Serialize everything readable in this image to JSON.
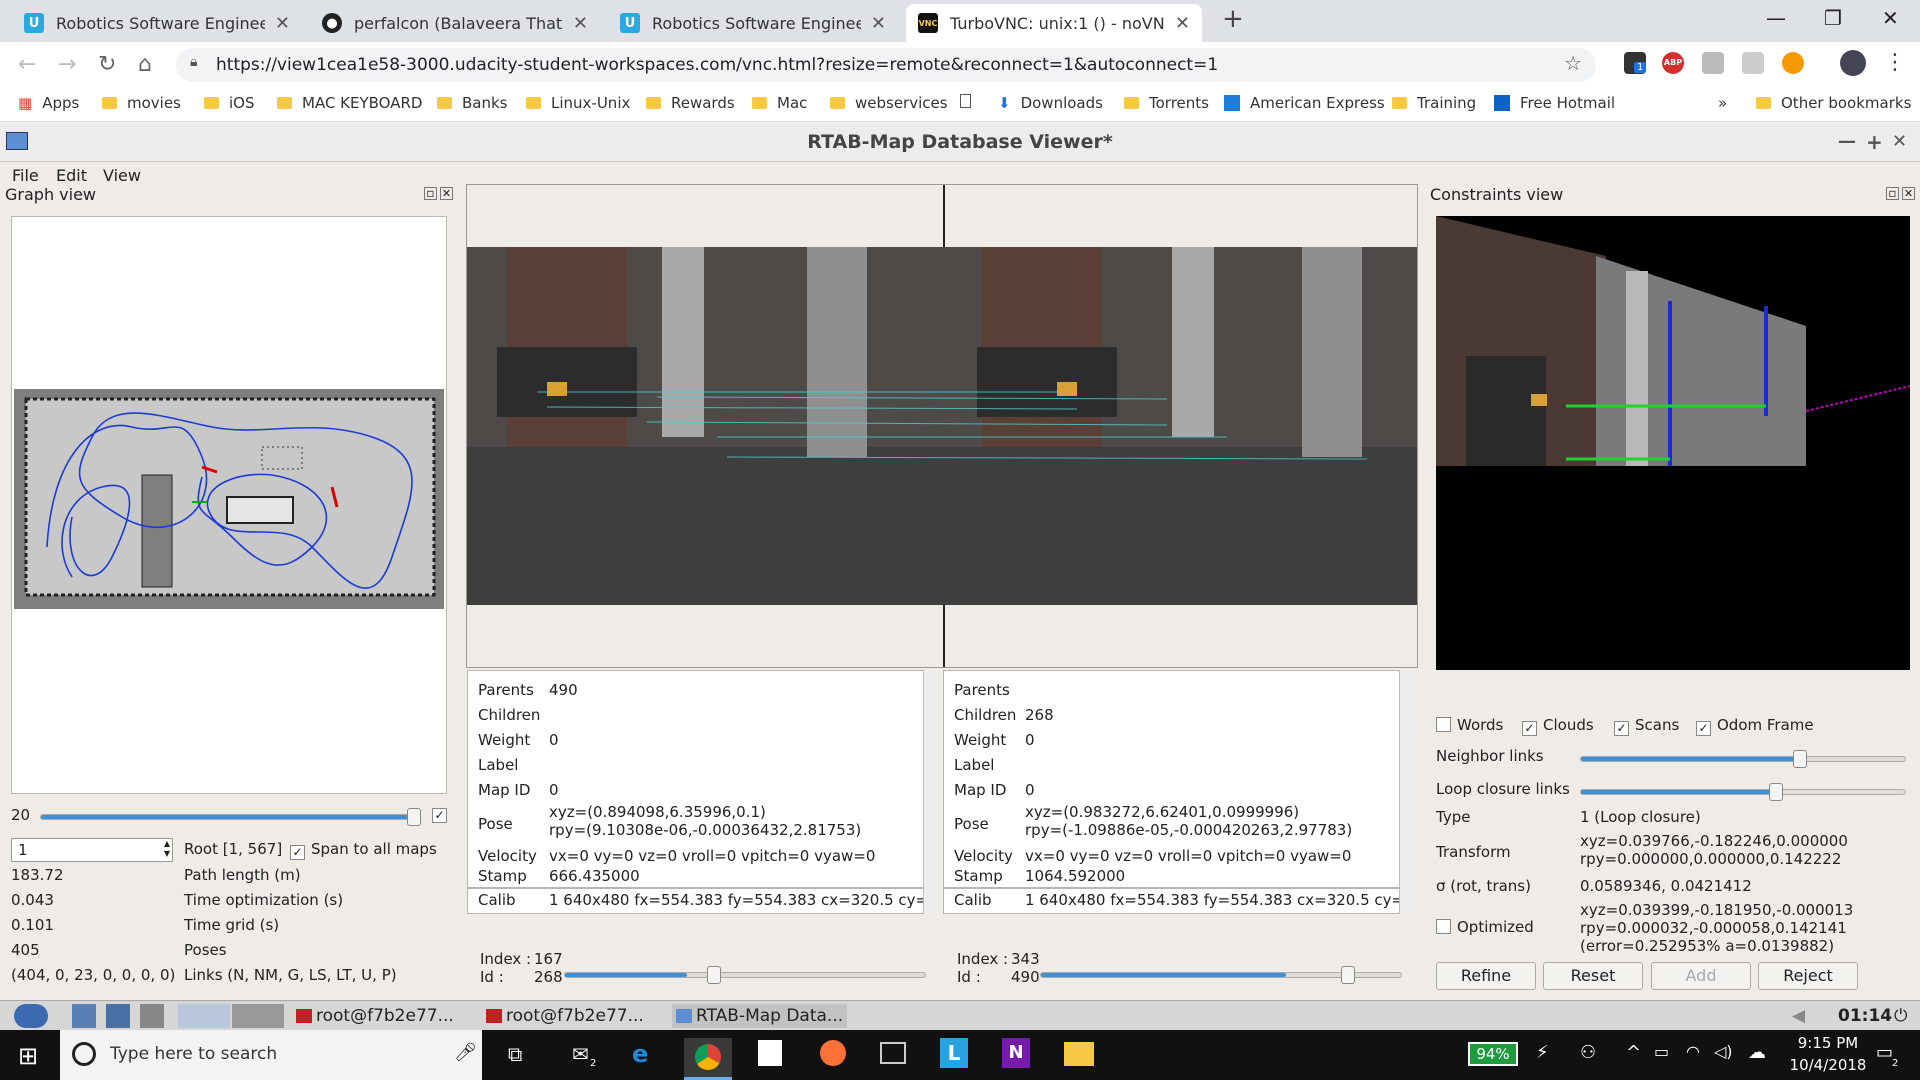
{
  "browser": {
    "tabs": [
      {
        "title": "Robotics Software Engineer - Udacity",
        "icon": "udacity-icon"
      },
      {
        "title": "perfalcon (Balaveera Thatikonda)",
        "icon": "github-icon"
      },
      {
        "title": "Robotics Software Engineer - Udacity",
        "icon": "udacity-icon"
      },
      {
        "title": "TurboVNC: unix:1 () - noVNC",
        "icon": "vnc-icon",
        "badge": "VNC"
      }
    ],
    "url": "https://view1cea1e58-3000.udacity-student-workspaces.com/vnc.html?resize=remote&reconnect=1&autoconnect=1",
    "ext_badge": "1",
    "bookmarks": [
      "Apps",
      "movies",
      "iOS",
      "MAC KEYBOARD",
      "Banks",
      "Linux-Unix",
      "Rewards",
      "Mac",
      "webservices",
      "",
      "Downloads",
      "Torrents",
      "American Express",
      "Training",
      "Free Hotmail"
    ],
    "more": "»",
    "other_bookmarks": "Other bookmarks"
  },
  "app": {
    "title": "RTAB-Map Database Viewer*",
    "menu": [
      "File",
      "Edit",
      "View"
    ],
    "graph_view": {
      "title": "Graph view",
      "slider_value": "20",
      "id_input": "1",
      "root_label": "Root [1, 567]",
      "span_label": "Span to all maps",
      "stats": [
        {
          "value": "183.72",
          "label": "Path length (m)"
        },
        {
          "value": "0.043",
          "label": "Time optimization (s)"
        },
        {
          "value": "0.101",
          "label": "Time grid (s)"
        },
        {
          "value": "405",
          "label": "Poses"
        },
        {
          "value": "(404, 0, 23, 0, 0, 0, 0)",
          "label": "Links (N, NM, G, LS, LT, U, P)"
        }
      ]
    },
    "left_node": {
      "parents": "490",
      "children": "",
      "weight": "0",
      "label": "",
      "map_id": "0",
      "pose1": "xyz=(0.894098,6.35996,0.1)",
      "pose2": "rpy=(9.10308e-06,-0.00036432,2.81753)",
      "velocity": "vx=0 vy=0 vz=0 vroll=0 vpitch=0 vyaw=0",
      "stamp": "666.435000",
      "calib": "1 640x480 fx=554.383 fy=554.383 cx=320.5 cy=",
      "index": "167",
      "id": "268"
    },
    "right_node": {
      "parents": "",
      "children": "268",
      "weight": "0",
      "label": "",
      "map_id": "0",
      "pose1": "xyz=(0.983272,6.62401,0.0999996)",
      "pose2": "rpy=(-1.09886e-05,-0.000420263,2.97783)",
      "velocity": "vx=0 vy=0 vz=0 vroll=0 vpitch=0 vyaw=0",
      "stamp": "1064.592000",
      "calib": "1 640x480 fx=554.383 fy=554.383 cx=320.5 cy=",
      "index": "343",
      "id": "490"
    },
    "field_labels": {
      "parents": "Parents",
      "children": "Children",
      "weight": "Weight",
      "label": "Label",
      "map_id": "Map ID",
      "pose": "Pose",
      "velocity": "Velocity",
      "stamp": "Stamp",
      "calib": "Calib",
      "index": "Index :",
      "id": "Id :"
    },
    "constraints": {
      "title": "Constraints view",
      "checks": [
        {
          "label": "Words",
          "checked": false
        },
        {
          "label": "Clouds",
          "checked": true
        },
        {
          "label": "Scans",
          "checked": true
        },
        {
          "label": "Odom Frame",
          "checked": true
        }
      ],
      "neighbor_links": "Neighbor links",
      "loop_closure_links": "Loop closure links",
      "type_label": "Type",
      "type_value": "1 (Loop closure)",
      "transform_label": "Transform",
      "transform1": "xyz=0.039766,-0.182246,0.000000",
      "transform2": "rpy=0.000000,0.000000,0.142222",
      "sigma_label": "σ (rot, trans)",
      "sigma_value": "0.0589346, 0.0421412",
      "optimized_label": "Optimized",
      "opt1": "xyz=0.039399,-0.181950,-0.000013",
      "opt2": "rpy=0.000032,-0.000058,0.142141",
      "opt3": "(error=0.252953% a=0.0139882)",
      "buttons": [
        "Refine",
        "Reset",
        "Add",
        "Reject"
      ]
    }
  },
  "vnc_taskbar": {
    "items": [
      "root@f7b2e77...",
      "root@f7b2e77...",
      "RTAB-Map Data..."
    ],
    "clock": "01:14"
  },
  "windows": {
    "search_placeholder": "Type here to search",
    "battery": "94%",
    "time": "9:15 PM",
    "date": "10/4/2018",
    "notif_count": "2",
    "cortana_badge": "2"
  },
  "colors": {
    "accent": "#1a73e8",
    "path": "#1a3bd6",
    "slider": "#3d8fd6"
  }
}
